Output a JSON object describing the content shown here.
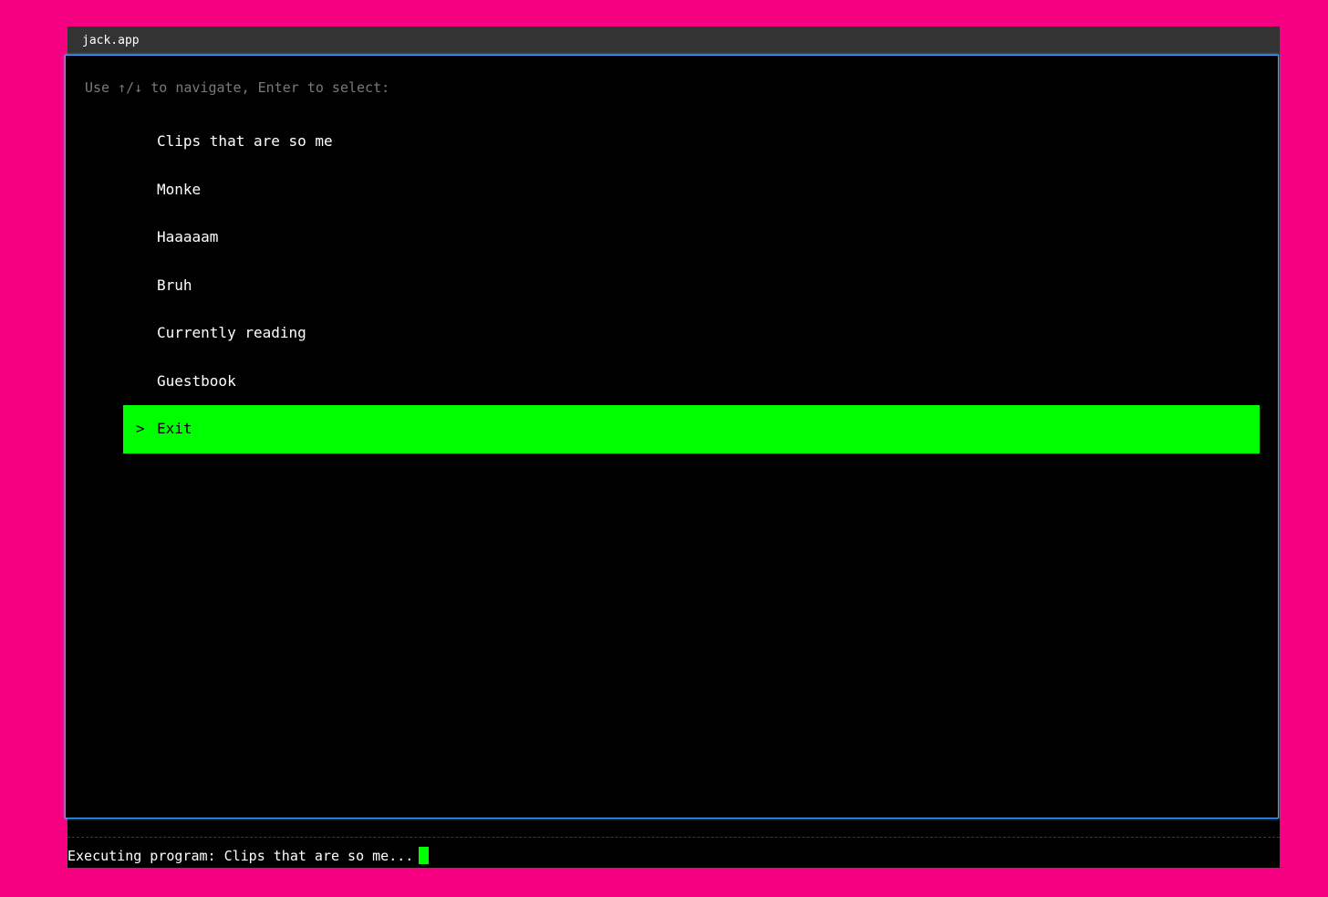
{
  "window": {
    "title": "jack.app"
  },
  "terminal": {
    "hint": "Use ↑/↓ to navigate, Enter to select:",
    "cursor_glyph": ">",
    "menu": [
      {
        "label": "Clips that are so me",
        "selected": false
      },
      {
        "label": "Monke",
        "selected": false
      },
      {
        "label": "Haaaaam",
        "selected": false
      },
      {
        "label": "Bruh",
        "selected": false
      },
      {
        "label": "Currently reading",
        "selected": false
      },
      {
        "label": "Guestbook",
        "selected": false
      },
      {
        "label": "Exit",
        "selected": true
      }
    ]
  },
  "status": {
    "text": "Executing program: Clips that are so me..."
  },
  "colors": {
    "background": "#f50080",
    "highlight": "#00ff00",
    "terminal_border": "#4aa3ff"
  }
}
